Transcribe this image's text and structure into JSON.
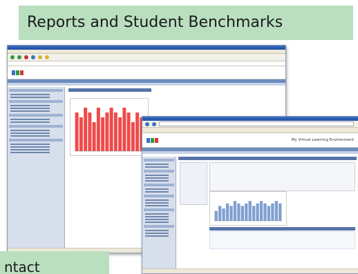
{
  "banner": {
    "title": "Reports and Student Benchmarks"
  },
  "contact": {
    "label": "ntact"
  },
  "colors": {
    "banner_bg": "#b9dfbf",
    "bars_back": "#ef4b4b",
    "bars_front": "#7fa0d0"
  },
  "back_window": {
    "chart_data": {
      "type": "bar",
      "values": [
        8,
        7,
        9,
        8,
        6,
        9,
        7,
        8,
        9,
        8,
        7,
        9,
        8,
        6,
        8,
        7
      ]
    }
  },
  "front_window": {
    "header": {
      "app_title": "My Virtual Learning Environment"
    },
    "chart_data": {
      "type": "bar",
      "values": [
        4,
        6,
        5,
        7,
        6,
        8,
        7,
        6,
        7,
        8,
        6,
        7,
        8,
        7,
        6,
        7,
        8,
        7
      ]
    }
  }
}
